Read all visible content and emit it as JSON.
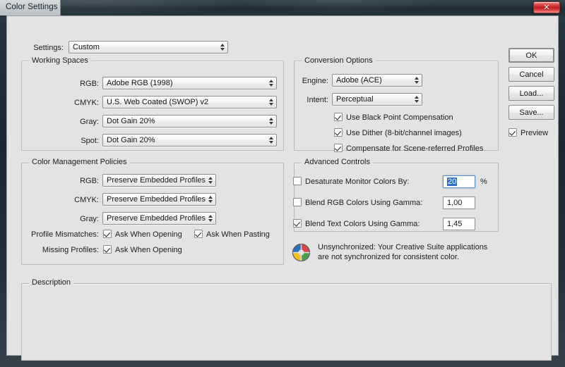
{
  "window": {
    "title": "Color Settings",
    "close_label": "✕"
  },
  "settings_row": {
    "label": "Settings:",
    "value": "Custom"
  },
  "working_spaces": {
    "title": "Working Spaces",
    "rows": [
      {
        "label": "RGB:",
        "value": "Adobe RGB (1998)"
      },
      {
        "label": "CMYK:",
        "value": "U.S. Web Coated (SWOP) v2"
      },
      {
        "label": "Gray:",
        "value": "Dot Gain 20%"
      },
      {
        "label": "Spot:",
        "value": "Dot Gain 20%"
      }
    ]
  },
  "color_management_policies": {
    "title": "Color Management Policies",
    "rows": [
      {
        "label": "RGB:",
        "value": "Preserve Embedded Profiles"
      },
      {
        "label": "CMYK:",
        "value": "Preserve Embedded Profiles"
      },
      {
        "label": "Gray:",
        "value": "Preserve Embedded Profiles"
      }
    ],
    "profile_mismatches_label": "Profile Mismatches:",
    "ask_when_opening_label": "Ask When Opening",
    "ask_when_pasting_label": "Ask When Pasting",
    "missing_profiles_label": "Missing Profiles:",
    "missing_ask_when_opening_label": "Ask When Opening",
    "profile_mismatch_opening_checked": true,
    "profile_mismatch_pasting_checked": true,
    "missing_profiles_opening_checked": true
  },
  "conversion_options": {
    "title": "Conversion Options",
    "engine_label": "Engine:",
    "engine_value": "Adobe (ACE)",
    "intent_label": "Intent:",
    "intent_value": "Perceptual",
    "checkboxes": [
      {
        "label": "Use Black Point Compensation",
        "checked": true
      },
      {
        "label": "Use Dither (8-bit/channel images)",
        "checked": true
      },
      {
        "label": "Compensate for Scene-referred Profiles",
        "checked": true
      }
    ]
  },
  "advanced_controls": {
    "title": "Advanced Controls",
    "rows": [
      {
        "label": "Desaturate Monitor Colors By:",
        "checked": false,
        "value": "20",
        "suffix": "%",
        "selected": true
      },
      {
        "label": "Blend RGB Colors Using Gamma:",
        "checked": false,
        "value": "1,00",
        "suffix": "",
        "selected": false
      },
      {
        "label": "Blend Text Colors Using Gamma:",
        "checked": true,
        "value": "1,45",
        "suffix": "",
        "selected": false
      }
    ]
  },
  "sync_status": {
    "icon": "color-wheel-icon",
    "line1": "Unsynchronized: Your Creative Suite applications",
    "line2": "are not synchronized for consistent color."
  },
  "buttons": {
    "ok": "OK",
    "cancel": "Cancel",
    "load": "Load...",
    "save": "Save...",
    "preview_label": "Preview",
    "preview_checked": true
  },
  "description": {
    "title": "Description",
    "text": ""
  },
  "colors": {
    "dialog_bg": "#e3e3e3",
    "titlebar": "#24333b",
    "close_red": "#c01d1d",
    "selection_blue": "#2d6fc4",
    "group_border": "#bcbcbc"
  }
}
